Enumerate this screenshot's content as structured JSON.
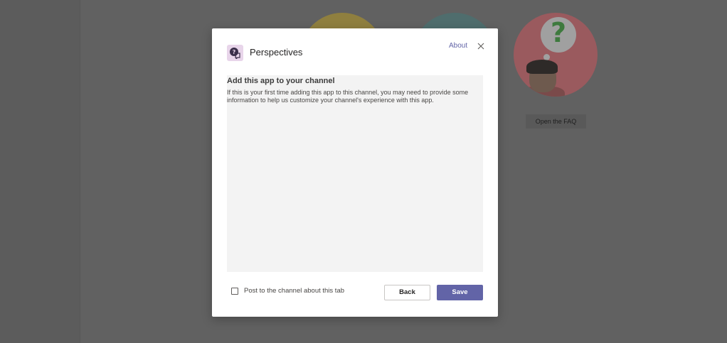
{
  "background": {
    "faq_button": "Open the FAQ"
  },
  "dialog": {
    "app_icon": "perspectives-app-icon",
    "title": "Perspectives",
    "about_link": "About",
    "close_icon": "close-icon",
    "content": {
      "heading": "Add this app to your channel",
      "description": "If this is your first time adding this app to this channel, you may need to provide some information to help us customize your channel's experience with this app."
    },
    "post_checkbox": {
      "label": "Post to the channel about this tab",
      "checked": false
    },
    "back_label": "Back",
    "save_label": "Save"
  },
  "colors": {
    "accent": "#6264a7",
    "overlay": "#5f5f5f",
    "content_bg": "#f3f3f3"
  }
}
